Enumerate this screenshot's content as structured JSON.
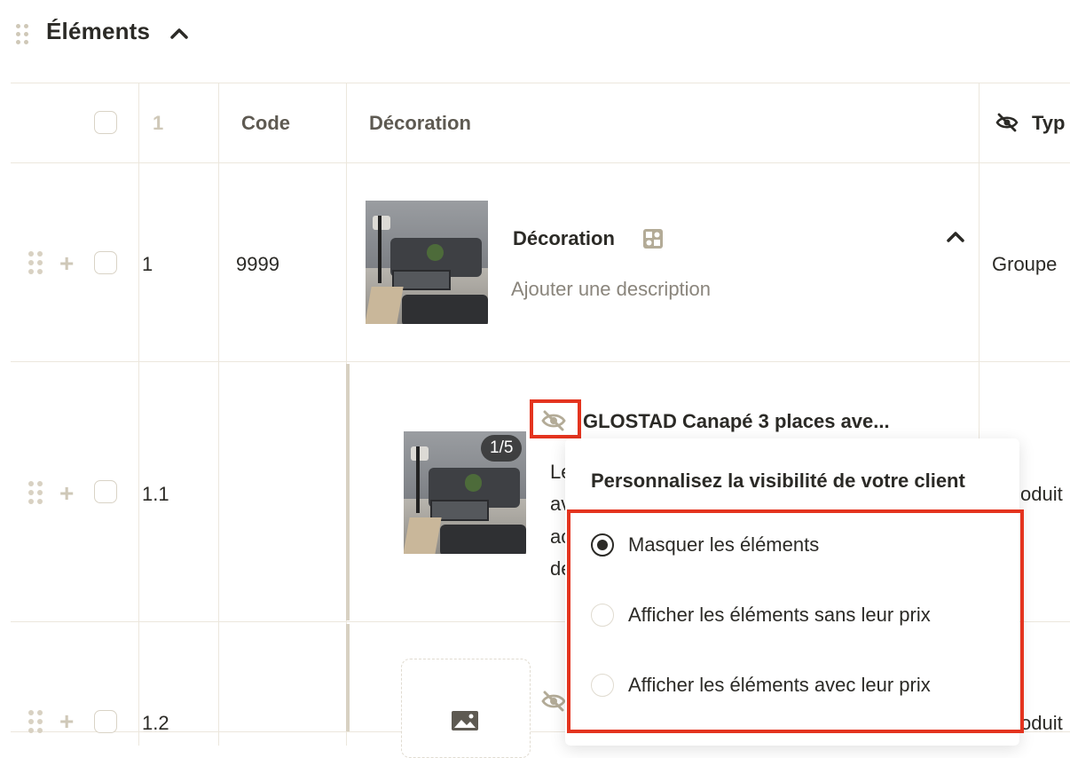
{
  "header": {
    "title": "Éléments"
  },
  "table": {
    "headers": {
      "index": "1",
      "code": "Code",
      "decoration": "Décoration",
      "type": "Typ"
    },
    "rows": [
      {
        "index": "1",
        "code": "9999",
        "title": "Décoration",
        "description_placeholder": "Ajouter une description",
        "type": "Groupe"
      },
      {
        "index": "1.1",
        "code": "",
        "title": "GLOSTAD Canapé 3 places ave...",
        "image_badge": "1/5",
        "desc_fragments": [
          "Le",
          "av",
          "ac",
          "de"
        ],
        "type": "oduit"
      },
      {
        "index": "1.2",
        "code": "",
        "type": "oduit"
      }
    ]
  },
  "visibility_popup": {
    "title": "Personnalisez la visibilité de votre client",
    "options": [
      {
        "label": "Masquer les éléments",
        "selected": true
      },
      {
        "label": "Afficher les éléments sans leur prix",
        "selected": false
      },
      {
        "label": "Afficher les éléments avec leur prix",
        "selected": false
      }
    ]
  },
  "colors": {
    "highlight": "#e4341f",
    "accent_muted": "#b3ab97",
    "text": "#2b2a26"
  },
  "icons": [
    "drag-handle-icon",
    "chevron-up-icon",
    "eye-off-icon",
    "puzzle-icon",
    "plus-icon",
    "image-icon"
  ]
}
